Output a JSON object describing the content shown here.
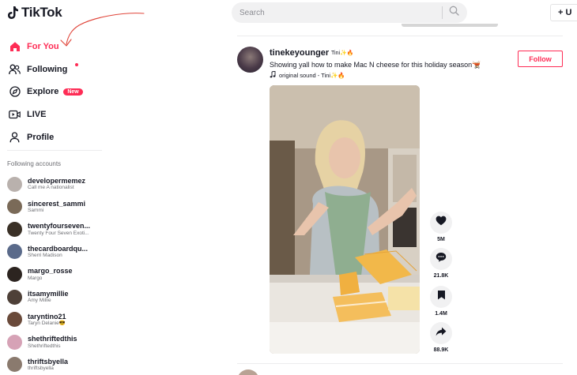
{
  "header": {
    "logo_text": "TikTok",
    "search_placeholder": "Search",
    "upload_label": "+ U"
  },
  "sidebar": {
    "nav": [
      {
        "label": "For You",
        "icon": "home-icon",
        "active": true
      },
      {
        "label": "Following",
        "icon": "following-icon",
        "has_dot": true
      },
      {
        "label": "Explore",
        "icon": "compass-icon",
        "badge": "New"
      },
      {
        "label": "LIVE",
        "icon": "live-icon"
      },
      {
        "label": "Profile",
        "icon": "person-icon"
      }
    ],
    "following_title": "Following accounts",
    "accounts": [
      {
        "user": "developermemez",
        "name": "Call me A nationalist",
        "color": "#b9b1ad"
      },
      {
        "user": "sincerest_sammi",
        "name": "Sammi",
        "color": "#7a6a58"
      },
      {
        "user": "twentyfourseven...",
        "name": "Twenty Four Seven Exoti...",
        "color": "#3a3026"
      },
      {
        "user": "thecardboardqu...",
        "name": "Sherri Madison",
        "color": "#5a6a8a"
      },
      {
        "user": "margo_rosse",
        "name": "Margo",
        "color": "#2c2420"
      },
      {
        "user": "itsamymillie",
        "name": "Amy Millie",
        "color": "#4e4038"
      },
      {
        "user": "taryntino21",
        "name": "Taryn Delanie😎",
        "color": "#6a4a3a"
      },
      {
        "user": "shethriftedthis",
        "name": "Shethriftedthis",
        "color": "#d6a2b6"
      },
      {
        "user": "thriftsbyella",
        "name": "thriftsbyella",
        "color": "#8a7a6e"
      }
    ]
  },
  "post": {
    "username": "tinekeyounger",
    "nickname": "Tini✨🔥",
    "caption": "Showing yall how to make Mac N cheese for this holiday season🫕",
    "sound": "original sound - Tini✨🔥",
    "follow_label": "Follow",
    "likes": "5M",
    "comments": "21.8K",
    "saves": "1.4M",
    "shares": "88.9K"
  },
  "colors": {
    "accent": "#fe2c55",
    "annotation": "#e0453a"
  }
}
